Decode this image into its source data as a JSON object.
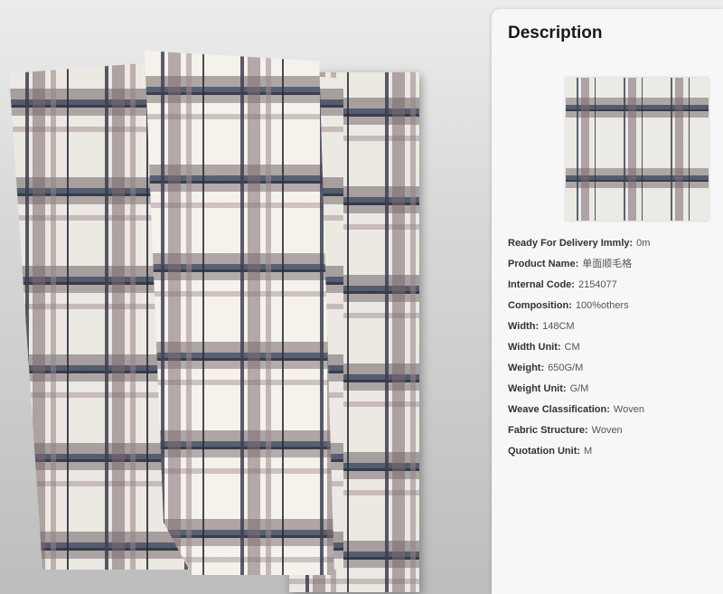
{
  "description": {
    "title": "Description",
    "specs": [
      {
        "label": "Ready For Delivery Immly:",
        "value": "0m"
      },
      {
        "label": "Product Name:",
        "value": "单面顺毛格"
      },
      {
        "label": "Internal Code:",
        "value": "2154077"
      },
      {
        "label": "Composition:",
        "value": "100%others"
      },
      {
        "label": "Width:",
        "value": "148CM"
      },
      {
        "label": "Width Unit:",
        "value": "CM"
      },
      {
        "label": "Weight:",
        "value": "650G/M"
      },
      {
        "label": "Weight Unit:",
        "value": "G/M"
      },
      {
        "label": "Weave Classification:",
        "value": "Woven"
      },
      {
        "label": "Fabric Structure:",
        "value": "Woven"
      },
      {
        "label": "Quotation Unit:",
        "value": "M"
      }
    ]
  }
}
